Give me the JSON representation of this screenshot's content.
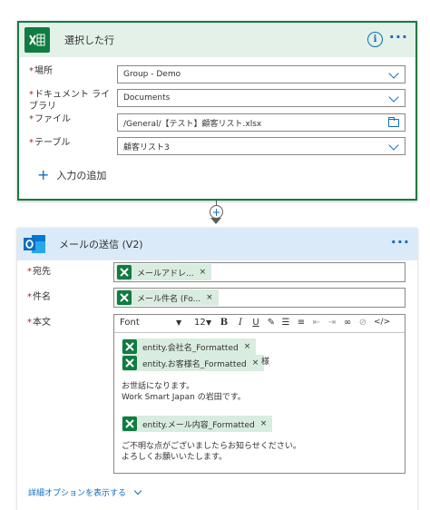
{
  "excel_card": {
    "title": "選択した行",
    "info_icon": "info-icon",
    "more_icon": "ellipsis-icon",
    "fields": [
      {
        "label": "場所",
        "value": "Group - Demo"
      },
      {
        "label": "ドキュメント ライブラリ",
        "value": "Documents"
      },
      {
        "label": "ファイル",
        "value": "/General/【テスト】顧客リスト.xlsx"
      },
      {
        "label": "テーブル",
        "value": "顧客リスト3"
      }
    ],
    "add_input_label": "入力の追加"
  },
  "connector": {
    "plus_icon": "add-step-icon"
  },
  "outlook_card": {
    "title": "メールの送信 (V2)",
    "to_label": "宛先",
    "to_token": "メールアドレ...",
    "subject_label": "件名",
    "subject_token": "メール件名 (Fo...",
    "body_label": "本文",
    "toolbar": {
      "font": "Font",
      "size": "12"
    },
    "body": {
      "token1": "entity.会社名_Formatted",
      "token2": "entity.お客様名_Formatted",
      "honorific": "様",
      "line1": "お世話になります。",
      "line2": "Work Smart Japan の岩田です。",
      "token3": "entity.メール内容_Formatted",
      "line3": "ご不明な点がございましたらお知らせください。",
      "line4": "よろしくお願いいたします。"
    },
    "advanced_options": "詳細オプションを表示する"
  },
  "colors": {
    "excel_green": "#107c41",
    "excel_header": "#e3f1e8",
    "outlook_header": "#daeaf8",
    "accent_blue": "#0f6cbd",
    "required_red": "#a4262c",
    "token_bg": "#d9ece0"
  }
}
